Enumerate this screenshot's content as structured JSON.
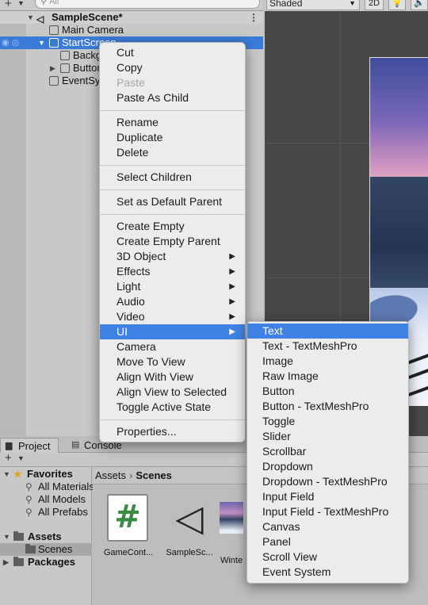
{
  "hierarchy": {
    "search_placeholder": "All",
    "scene_name": "SampleScene*",
    "items": [
      {
        "label": "Main Camera"
      },
      {
        "label": "StartScreen"
      },
      {
        "label": "Backg"
      },
      {
        "label": "Buttor"
      },
      {
        "label": "EventSy"
      }
    ]
  },
  "scene_view": {
    "shading_mode": "Shaded",
    "mode_2d": "2D"
  },
  "context_menu": {
    "items": [
      {
        "label": "Cut"
      },
      {
        "label": "Copy"
      },
      {
        "label": "Paste",
        "disabled": true
      },
      {
        "label": "Paste As Child"
      },
      {
        "label": "Rename"
      },
      {
        "label": "Duplicate"
      },
      {
        "label": "Delete"
      },
      {
        "label": "Select Children"
      },
      {
        "label": "Set as Default Parent"
      },
      {
        "label": "Create Empty"
      },
      {
        "label": "Create Empty Parent"
      },
      {
        "label": "3D Object",
        "submenu": true
      },
      {
        "label": "Effects",
        "submenu": true
      },
      {
        "label": "Light",
        "submenu": true
      },
      {
        "label": "Audio",
        "submenu": true
      },
      {
        "label": "Video",
        "submenu": true
      },
      {
        "label": "UI",
        "submenu": true,
        "highlighted": true
      },
      {
        "label": "Camera"
      },
      {
        "label": "Move To View"
      },
      {
        "label": "Align With View"
      },
      {
        "label": "Align View to Selected"
      },
      {
        "label": "Toggle Active State"
      },
      {
        "label": "Properties..."
      }
    ],
    "submenu_arrow": "▶"
  },
  "ui_submenu": {
    "items": [
      {
        "label": "Text",
        "highlighted": true
      },
      {
        "label": "Text - TextMeshPro"
      },
      {
        "label": "Image"
      },
      {
        "label": "Raw Image"
      },
      {
        "label": "Button"
      },
      {
        "label": "Button - TextMeshPro"
      },
      {
        "label": "Toggle"
      },
      {
        "label": "Slider"
      },
      {
        "label": "Scrollbar"
      },
      {
        "label": "Dropdown"
      },
      {
        "label": "Dropdown - TextMeshPro"
      },
      {
        "label": "Input Field"
      },
      {
        "label": "Input Field - TextMeshPro"
      },
      {
        "label": "Canvas"
      },
      {
        "label": "Panel"
      },
      {
        "label": "Scroll View"
      },
      {
        "label": "Event System"
      }
    ]
  },
  "project": {
    "tabs": [
      {
        "label": "Project",
        "active": true
      },
      {
        "label": "Console"
      }
    ],
    "tree": {
      "favorites": "Favorites",
      "favorite_items": [
        "All Materials",
        "All Models",
        "All Prefabs"
      ],
      "assets": "Assets",
      "scenes": "Scenes",
      "packages": "Packages"
    },
    "breadcrumb": [
      "Assets",
      "Scenes"
    ],
    "assets": [
      {
        "name": "GameCont...",
        "icon": "csharp-script-icon"
      },
      {
        "name": "SampleSc...",
        "icon": "unity-scene-icon"
      },
      {
        "name": "Winte",
        "icon": "texture-icon"
      }
    ]
  }
}
